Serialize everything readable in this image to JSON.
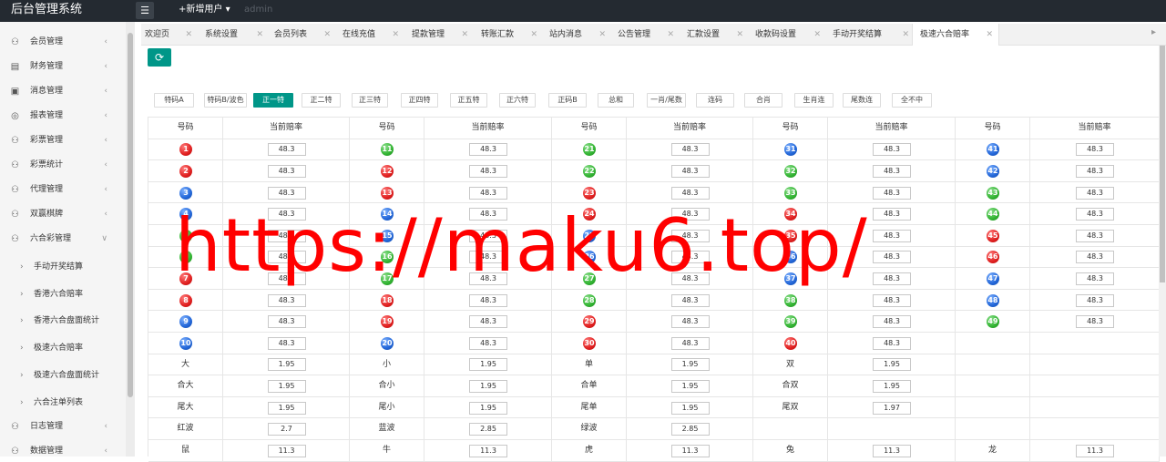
{
  "app": {
    "title": "后台管理系统",
    "new_user": "+新增用户",
    "username": "admin"
  },
  "sidebar": {
    "items": [
      {
        "label": "会员管理",
        "icon": "user-icon"
      },
      {
        "label": "财务管理",
        "icon": "wallet-icon"
      },
      {
        "label": "消息管理",
        "icon": "message-icon"
      },
      {
        "label": "报表管理",
        "icon": "report-icon"
      },
      {
        "label": "彩票管理",
        "icon": "lottery-icon"
      },
      {
        "label": "彩票统计",
        "icon": "stats-icon"
      },
      {
        "label": "代理管理",
        "icon": "agent-icon"
      },
      {
        "label": "双赢棋牌",
        "icon": "card-icon"
      },
      {
        "label": "六合彩管理",
        "icon": "mark-six-icon"
      }
    ],
    "sub_items": [
      "手动开奖结算",
      "香港六合赔率",
      "香港六合盘面统计",
      "极速六合赔率",
      "极速六合盘面统计",
      "六合注单列表"
    ],
    "bottom_items": [
      {
        "label": "日志管理",
        "icon": "log-icon"
      },
      {
        "label": "数据管理",
        "icon": "data-icon"
      }
    ]
  },
  "tabs": [
    "欢迎页",
    "系统设置",
    "会员列表",
    "在线充值",
    "提款管理",
    "转账汇款",
    "站内消息",
    "公告管理",
    "汇款设置",
    "收款码设置",
    "手动开奖结算",
    "极速六合赔率"
  ],
  "active_tab": "极速六合赔率",
  "filters": [
    "特码A",
    "特码B/波色",
    "正一特",
    "正二特",
    "正三特",
    "正四特",
    "正五特",
    "正六特",
    "正码B",
    "总和",
    "一肖/尾数",
    "连码",
    "合肖",
    "生肖连",
    "尾数连",
    "全不中"
  ],
  "active_filter": "正一特",
  "table": {
    "header_number": "号码",
    "header_rate": "当前赔率",
    "number_rate": "48.3",
    "columns": [
      [
        {
          "n": "1",
          "c": "red"
        },
        {
          "n": "2",
          "c": "red"
        },
        {
          "n": "3",
          "c": "blue"
        },
        {
          "n": "4",
          "c": "blue"
        },
        {
          "n": "5",
          "c": "green"
        },
        {
          "n": "6",
          "c": "green"
        },
        {
          "n": "7",
          "c": "red"
        },
        {
          "n": "8",
          "c": "red"
        },
        {
          "n": "9",
          "c": "blue"
        },
        {
          "n": "10",
          "c": "blue"
        }
      ],
      [
        {
          "n": "11",
          "c": "green"
        },
        {
          "n": "12",
          "c": "red"
        },
        {
          "n": "13",
          "c": "red"
        },
        {
          "n": "14",
          "c": "blue"
        },
        {
          "n": "15",
          "c": "blue"
        },
        {
          "n": "16",
          "c": "green"
        },
        {
          "n": "17",
          "c": "green"
        },
        {
          "n": "18",
          "c": "red"
        },
        {
          "n": "19",
          "c": "red"
        },
        {
          "n": "20",
          "c": "blue"
        }
      ],
      [
        {
          "n": "21",
          "c": "green"
        },
        {
          "n": "22",
          "c": "green"
        },
        {
          "n": "23",
          "c": "red"
        },
        {
          "n": "24",
          "c": "red"
        },
        {
          "n": "25",
          "c": "blue"
        },
        {
          "n": "26",
          "c": "blue"
        },
        {
          "n": "27",
          "c": "green"
        },
        {
          "n": "28",
          "c": "green"
        },
        {
          "n": "29",
          "c": "red"
        },
        {
          "n": "30",
          "c": "red"
        }
      ],
      [
        {
          "n": "31",
          "c": "blue"
        },
        {
          "n": "32",
          "c": "green"
        },
        {
          "n": "33",
          "c": "green"
        },
        {
          "n": "34",
          "c": "red"
        },
        {
          "n": "35",
          "c": "red"
        },
        {
          "n": "36",
          "c": "blue"
        },
        {
          "n": "37",
          "c": "blue"
        },
        {
          "n": "38",
          "c": "green"
        },
        {
          "n": "39",
          "c": "green"
        },
        {
          "n": "40",
          "c": "red"
        }
      ],
      [
        {
          "n": "41",
          "c": "blue"
        },
        {
          "n": "42",
          "c": "blue"
        },
        {
          "n": "43",
          "c": "green"
        },
        {
          "n": "44",
          "c": "green"
        },
        {
          "n": "45",
          "c": "red"
        },
        {
          "n": "46",
          "c": "red"
        },
        {
          "n": "47",
          "c": "blue"
        },
        {
          "n": "48",
          "c": "blue"
        },
        {
          "n": "49",
          "c": "green"
        }
      ]
    ],
    "extra_rows": [
      [
        {
          "l": "大",
          "v": "1.95"
        },
        {
          "l": "小",
          "v": "1.95"
        },
        {
          "l": "单",
          "v": "1.95"
        },
        {
          "l": "双",
          "v": "1.95"
        }
      ],
      [
        {
          "l": "合大",
          "v": "1.95"
        },
        {
          "l": "合小",
          "v": "1.95"
        },
        {
          "l": "合单",
          "v": "1.95"
        },
        {
          "l": "合双",
          "v": "1.95"
        }
      ],
      [
        {
          "l": "尾大",
          "v": "1.95"
        },
        {
          "l": "尾小",
          "v": "1.95"
        },
        {
          "l": "尾单",
          "v": "1.95"
        },
        {
          "l": "尾双",
          "v": "1.97"
        }
      ],
      [
        {
          "l": "红波",
          "v": "2.7"
        },
        {
          "l": "蓝波",
          "v": "2.85"
        },
        {
          "l": "绿波",
          "v": "2.85"
        }
      ],
      [
        {
          "l": "鼠",
          "v": "11.3"
        },
        {
          "l": "牛",
          "v": "11.3"
        },
        {
          "l": "虎",
          "v": "11.3"
        },
        {
          "l": "兔",
          "v": "11.3"
        },
        {
          "l": "龙",
          "v": "11.3"
        }
      ]
    ]
  },
  "watermark": "https://maku6.top/",
  "colors": {
    "accent": "#009688",
    "topbar": "#242a31",
    "watermark": "#ff0000"
  }
}
